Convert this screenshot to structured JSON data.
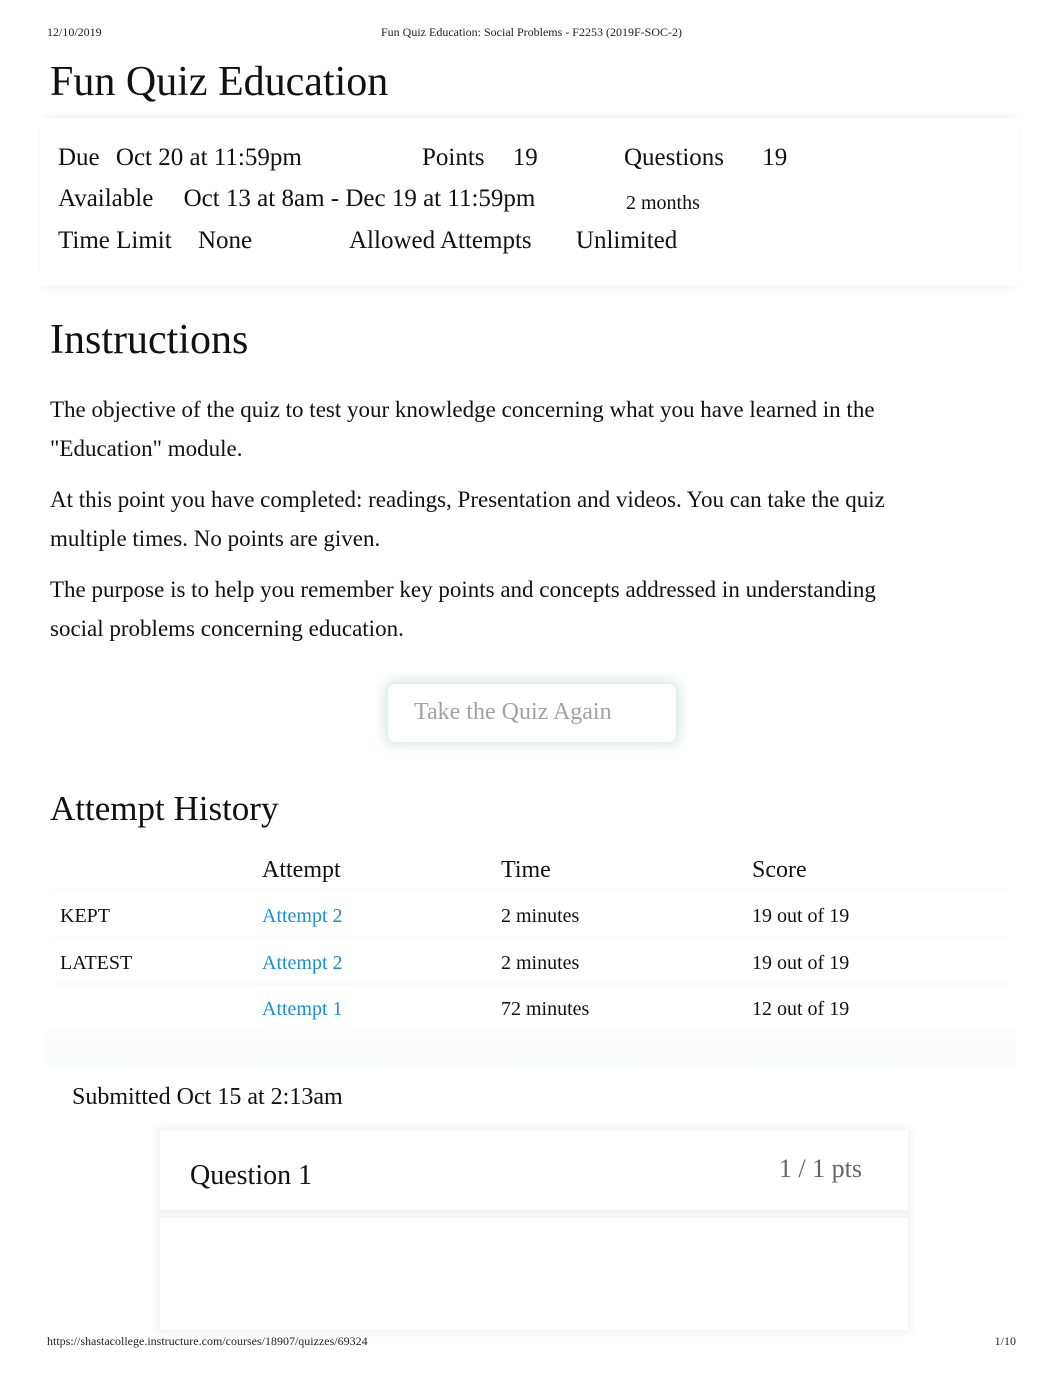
{
  "print_header": {
    "date": "12/10/2019",
    "document_title": "Fun Quiz Education: Social Problems - F2253 (2019F-SOC-2)"
  },
  "page_title": "Fun Quiz Education",
  "quiz_details": {
    "due": {
      "label": "Due",
      "value": "Oct 20 at 11:59pm"
    },
    "points": {
      "label": "Points",
      "value": "19"
    },
    "questions": {
      "label": "Questions",
      "value": "19"
    },
    "available": {
      "label": "Available",
      "value": "Oct 13 at 8am - Dec 19 at 11:59pm",
      "duration": "2 months"
    },
    "time_limit": {
      "label": "Time Limit",
      "value": "None"
    },
    "allowed_attempts": {
      "label": "Allowed Attempts",
      "value": "Unlimited"
    }
  },
  "instructions": {
    "heading": "Instructions",
    "paragraphs": [
      "The objective of the quiz to test your knowledge concerning what you have learned in the \"Education\" module.",
      "At this point you have completed: readings, Presentation and videos. You can take the quiz multiple times. No points are given.",
      "The purpose is to help you remember key points and concepts addressed in understanding social problems concerning education."
    ]
  },
  "take_quiz_button": "Take the Quiz Again",
  "attempt_history": {
    "heading": "Attempt History",
    "columns": [
      "",
      "Attempt",
      "Time",
      "Score"
    ],
    "rows": [
      {
        "tag": "KEPT",
        "attempt": "Attempt 2",
        "time": "2 minutes",
        "score": "19 out of 19"
      },
      {
        "tag": "LATEST",
        "attempt": "Attempt 2",
        "time": "2 minutes",
        "score": "19 out of 19"
      },
      {
        "tag": "",
        "attempt": "Attempt 1",
        "time": "72 minutes",
        "score": "12 out of 19"
      }
    ]
  },
  "submitted": "Submitted Oct 15 at 2:13am",
  "question": {
    "title": "Question 1",
    "points": "1 / 1 pts"
  },
  "print_footer": {
    "url": "https://shastacollege.instructure.com/courses/18907/quizzes/69324",
    "page": "1/10"
  },
  "colors": {
    "link": "#1a8fd8",
    "button_text": "#a2a2a2",
    "points_text": "#666666"
  }
}
